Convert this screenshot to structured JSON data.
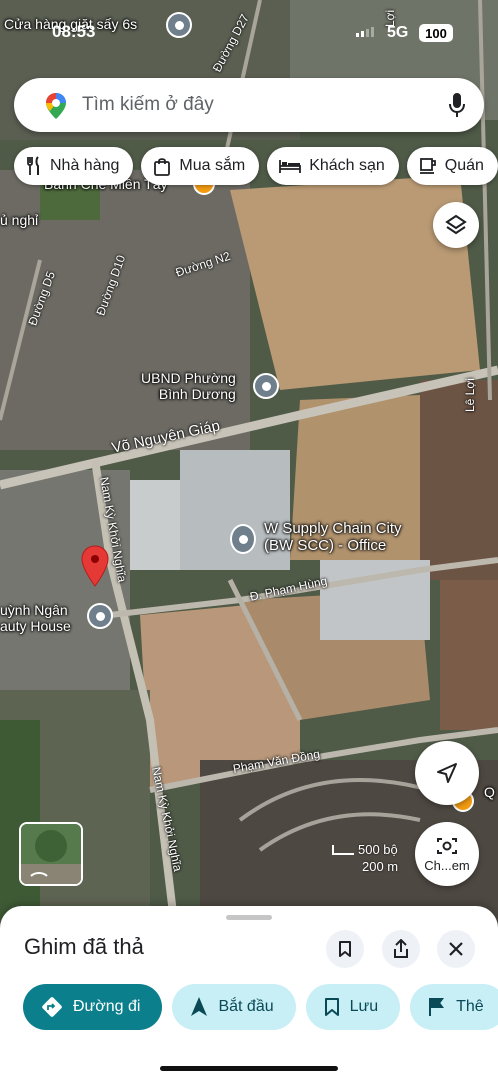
{
  "status_bar": {
    "time": "08:53",
    "network": "5G",
    "battery": "100"
  },
  "search": {
    "placeholder": "Tìm kiếm ở đây"
  },
  "chips": [
    {
      "label": "Nhà hàng",
      "icon": "fork-knife-icon"
    },
    {
      "label": "Mua sắm",
      "icon": "shopping-bag-icon"
    },
    {
      "label": "Khách sạn",
      "icon": "bed-icon"
    },
    {
      "label": "Quán",
      "icon": "coffee-cup-icon"
    }
  ],
  "map": {
    "places": {
      "laundry": "Cửa hàng giặt sấy 6s",
      "banh_che": "Bánh Chè Miền Tây",
      "u_nghi": "ủ nghỉ",
      "ubnd": "UBND Phường\nBình Dương",
      "bw_supply": "W Supply Chain City\n(BW SCC) - Office",
      "beauty": "uỳnh Ngân\nauty House",
      "q_right": "Q"
    },
    "roads": {
      "d27": "Đường D27",
      "le_loi_top": "Lợi",
      "d5": "Đường D5",
      "d10": "Đường D10",
      "n2": "Đường N2",
      "le_loi": "Lê Lợi",
      "vo_nguyen_giap": "Võ Nguyên Giáp",
      "nam_ky_1": "Nam Kỳ Khởi Nghĩa",
      "pham_hung": "Đ. Phạm Hùng",
      "pham_van_dong": "Phạm Văn Đồng",
      "nam_ky_2": "Nam Kỳ Khởi Nghĩa"
    },
    "scale": {
      "imperial": "500 bộ",
      "metric": "200 m"
    },
    "camera_label": "Ch...em",
    "pin_color": "#e53935"
  },
  "sheet": {
    "title": "Ghim đã thả",
    "buttons": {
      "directions": "Đường đi",
      "start": "Bắt đầu",
      "save": "Lưu",
      "more": "Thê"
    }
  },
  "colors": {
    "accent": "#0b7f8c",
    "secondary": "#c8eff6"
  }
}
